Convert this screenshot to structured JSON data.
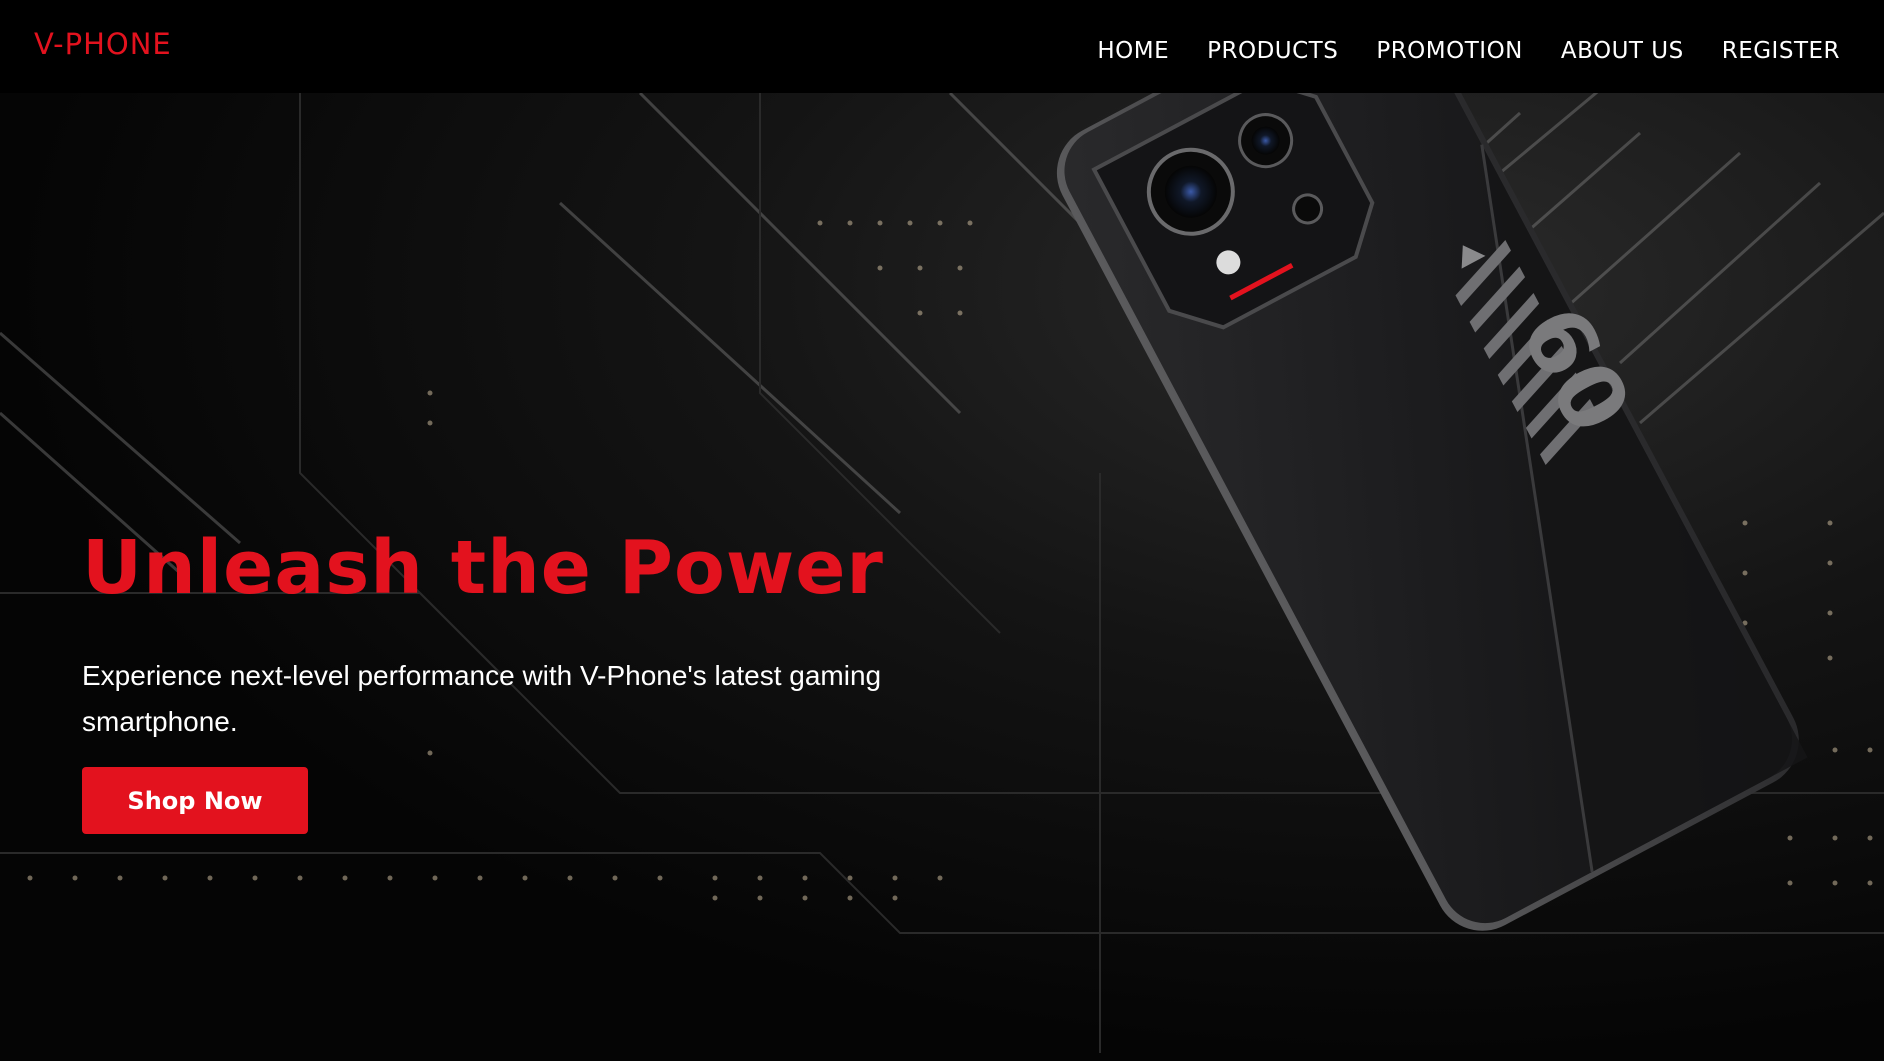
{
  "brand": {
    "logo_text": "V-PHONE",
    "accent_color": "#e3121e"
  },
  "nav": {
    "items": [
      {
        "label": "HOME"
      },
      {
        "label": "PRODUCTS"
      },
      {
        "label": "PROMOTION"
      },
      {
        "label": "ABOUT US"
      },
      {
        "label": "REGISTER"
      }
    ]
  },
  "hero": {
    "title": "Unleash the Power",
    "subtitle": "Experience next-level performance with V-Phone's latest gaming smartphone.",
    "cta_label": "Shop Now",
    "image": "gaming-phone-image",
    "phone_back_text": "60"
  }
}
